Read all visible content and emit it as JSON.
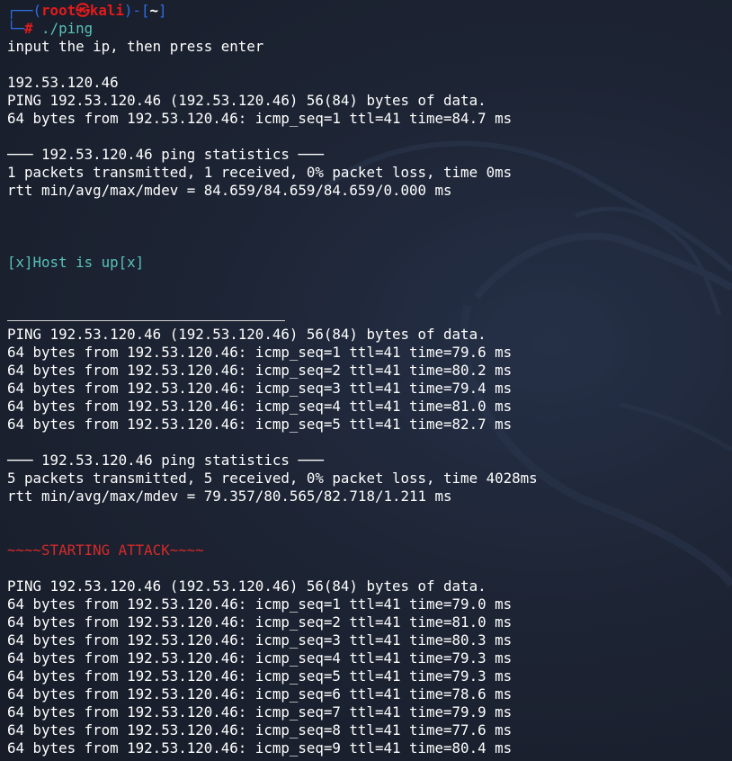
{
  "prompt": {
    "corner_top": "┌──(",
    "user": "root",
    "at": "㉿",
    "host": "kali",
    "close": ")-[",
    "dir": "~",
    "close_bracket": "]",
    "corner_bottom": "└─",
    "hash": "#",
    "command": " ./ping"
  },
  "intro": "input the ip, then press enter",
  "ip_input": "192.53.120.46",
  "first_ping": {
    "header": "PING 192.53.120.46 (192.53.120.46) 56(84) bytes of data.",
    "lines": [
      "64 bytes from 192.53.120.46: icmp_seq=1 ttl=41 time=84.7 ms"
    ],
    "stats_header": "─── 192.53.120.46 ping statistics ───",
    "summary": "1 packets transmitted, 1 received, 0% packet loss, time 0ms",
    "rtt": "rtt min/avg/max/mdev = 84.659/84.659/84.659/0.000 ms"
  },
  "host_status": "[x]Host is up[x]",
  "second_ping": {
    "header": "PING 192.53.120.46 (192.53.120.46) 56(84) bytes of data.",
    "lines": [
      "64 bytes from 192.53.120.46: icmp_seq=1 ttl=41 time=79.6 ms",
      "64 bytes from 192.53.120.46: icmp_seq=2 ttl=41 time=80.2 ms",
      "64 bytes from 192.53.120.46: icmp_seq=3 ttl=41 time=79.4 ms",
      "64 bytes from 192.53.120.46: icmp_seq=4 ttl=41 time=81.0 ms",
      "64 bytes from 192.53.120.46: icmp_seq=5 ttl=41 time=82.7 ms"
    ],
    "stats_header": "─── 192.53.120.46 ping statistics ───",
    "summary": "5 packets transmitted, 5 received, 0% packet loss, time 4028ms",
    "rtt": "rtt min/avg/max/mdev = 79.357/80.565/82.718/1.211 ms"
  },
  "attack_banner": "~~~~STARTING ATTACK~~~~",
  "attack_ping": {
    "header": "PING 192.53.120.46 (192.53.120.46) 56(84) bytes of data.",
    "lines": [
      "64 bytes from 192.53.120.46: icmp_seq=1 ttl=41 time=79.0 ms",
      "64 bytes from 192.53.120.46: icmp_seq=2 ttl=41 time=81.0 ms",
      "64 bytes from 192.53.120.46: icmp_seq=3 ttl=41 time=80.3 ms",
      "64 bytes from 192.53.120.46: icmp_seq=4 ttl=41 time=79.3 ms",
      "64 bytes from 192.53.120.46: icmp_seq=5 ttl=41 time=79.3 ms",
      "64 bytes from 192.53.120.46: icmp_seq=6 ttl=41 time=78.6 ms",
      "64 bytes from 192.53.120.46: icmp_seq=7 ttl=41 time=79.9 ms",
      "64 bytes from 192.53.120.46: icmp_seq=8 ttl=41 time=77.6 ms",
      "64 bytes from 192.53.120.46: icmp_seq=9 ttl=41 time=80.4 ms"
    ]
  },
  "colors": {
    "background": "#1b2130",
    "prompt_frame": "#2f6ee0",
    "prompt_user": "#e31b1b",
    "host_status": "#58c2b9",
    "attack_banner": "#d62a2a",
    "text": "#ffffff"
  }
}
